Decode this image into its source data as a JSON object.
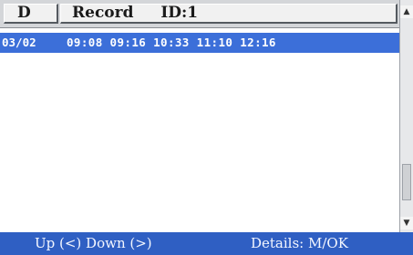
{
  "header": {
    "col_d": "D",
    "col_record": "Record",
    "id_label": "ID:1"
  },
  "rows": [
    {
      "date": "03/02",
      "times": "09:08 09:16 10:33 11:10 12:16"
    }
  ],
  "footer": {
    "nav_hint": "Up (<) Down (>)",
    "details_hint": "Details: M/OK"
  },
  "colors": {
    "selected_row": "#3c6fd9",
    "footer_bg": "#2f5fc3",
    "header_bg": "#d4d6d9"
  },
  "icons": {
    "scroll_up": "triangle-up-icon",
    "scroll_down": "triangle-down-icon"
  }
}
